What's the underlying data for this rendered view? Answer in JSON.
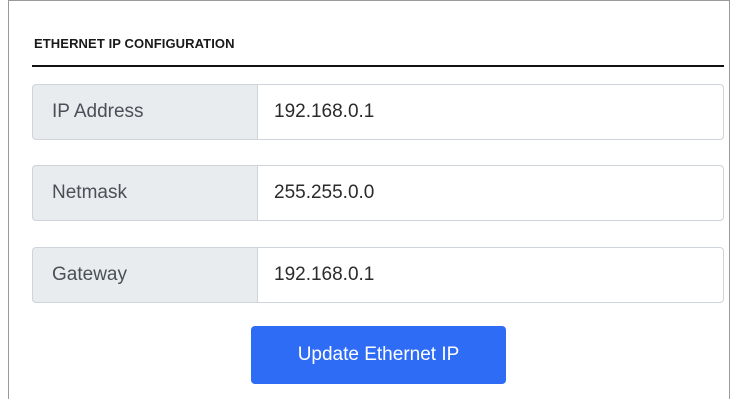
{
  "section": {
    "title": "ETHERNET IP CONFIGURATION"
  },
  "fields": {
    "ip_address": {
      "label": "IP Address",
      "value": "192.168.0.1"
    },
    "netmask": {
      "label": "Netmask",
      "value": "255.255.0.0"
    },
    "gateway": {
      "label": "Gateway",
      "value": "192.168.0.1"
    }
  },
  "actions": {
    "update_label": "Update Ethernet IP"
  },
  "colors": {
    "accent": "#2e6cf6",
    "label_bg": "#e9ecef",
    "border": "#ced4da"
  }
}
